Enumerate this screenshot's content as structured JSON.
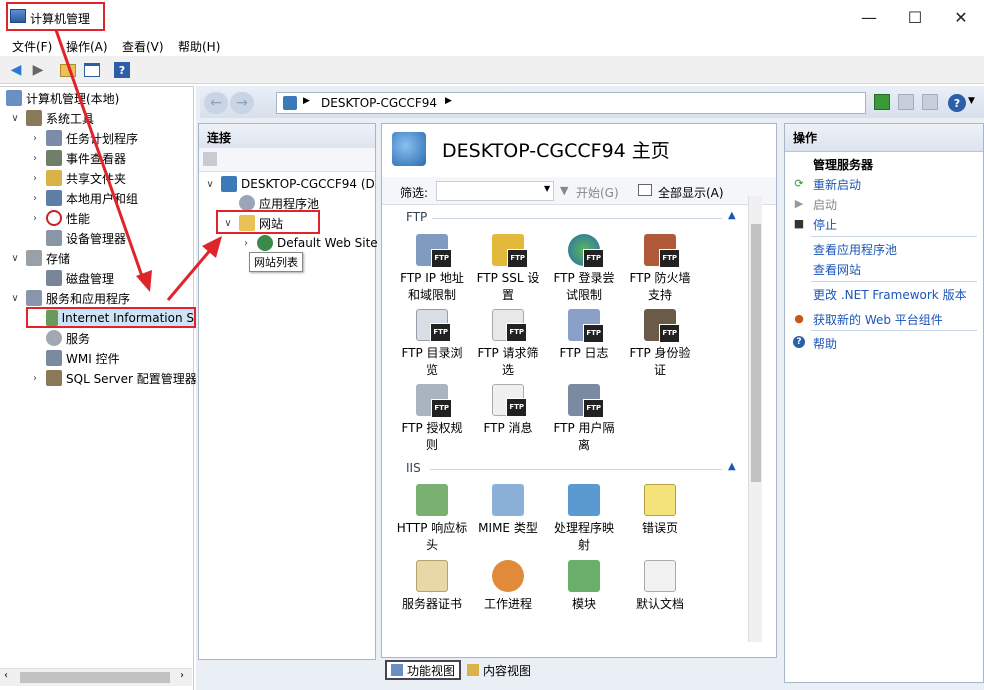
{
  "window": {
    "title": "计算机管理",
    "minimize": "—",
    "maximize": "☐",
    "close": "✕"
  },
  "menu": [
    "文件(F)",
    "操作(A)",
    "查看(V)",
    "帮助(H)"
  ],
  "tree": {
    "root": "计算机管理(本地)",
    "system_tools": "系统工具",
    "task_scheduler": "任务计划程序",
    "event_viewer": "事件查看器",
    "shared_folders": "共享文件夹",
    "local_users": "本地用户和组",
    "performance": "性能",
    "device_manager": "设备管理器",
    "storage": "存储",
    "disk_management": "磁盘管理",
    "services_apps": "服务和应用程序",
    "iis": "Internet Information S",
    "services": "服务",
    "wmi": "WMI 控件",
    "sql": "SQL Server 配置管理器"
  },
  "address": {
    "crumb": "DESKTOP-CGCCF94"
  },
  "connections": {
    "header": "连接",
    "server": "DESKTOP-CGCCF94 (D",
    "app_pools": "应用程序池",
    "sites": "网站",
    "default_site": "Default Web Site",
    "tooltip": "网站列表"
  },
  "home": {
    "title": "DESKTOP-CGCCF94 主页",
    "filter_label": "筛选:",
    "start_label": "开始(G)",
    "show_all_label": "全部显示(A)",
    "section_ftp": "FTP",
    "section_iis": "IIS",
    "ftp_features": [
      {
        "l1": "FTP IP 地址",
        "l2": "和域限制"
      },
      {
        "l1": "FTP SSL 设",
        "l2": "置"
      },
      {
        "l1": "FTP 登录尝",
        "l2": "试限制"
      },
      {
        "l1": "FTP 防火墙",
        "l2": "支持"
      },
      {
        "l1": "FTP 目录浏",
        "l2": "览"
      },
      {
        "l1": "FTP 请求筛",
        "l2": "选"
      },
      {
        "l1": "FTP 日志",
        "l2": ""
      },
      {
        "l1": "FTP 身份验",
        "l2": "证"
      },
      {
        "l1": "FTP 授权规",
        "l2": "则"
      },
      {
        "l1": "FTP 消息",
        "l2": ""
      },
      {
        "l1": "FTP 用户隔",
        "l2": "离"
      }
    ],
    "iis_features": [
      {
        "l1": "HTTP 响应标",
        "l2": "头"
      },
      {
        "l1": "MIME 类型",
        "l2": ""
      },
      {
        "l1": "处理程序映",
        "l2": "射"
      },
      {
        "l1": "错误页",
        "l2": ""
      },
      {
        "l1": "服务器证书",
        "l2": ""
      },
      {
        "l1": "工作进程",
        "l2": ""
      },
      {
        "l1": "模块",
        "l2": ""
      },
      {
        "l1": "默认文档",
        "l2": ""
      }
    ],
    "tab_features": "功能视图",
    "tab_content": "内容视图"
  },
  "actions": {
    "header": "操作",
    "manage_server": "管理服务器",
    "restart": "重新启动",
    "start": "启动",
    "stop": "停止",
    "view_app_pools": "查看应用程序池",
    "view_sites": "查看网站",
    "change_net": "更改 .NET Framework 版本",
    "get_components": "获取新的 Web 平台组件",
    "help": "帮助"
  },
  "colors": {
    "annotation_red": "#e0242b",
    "link_blue": "#1a56b8"
  }
}
